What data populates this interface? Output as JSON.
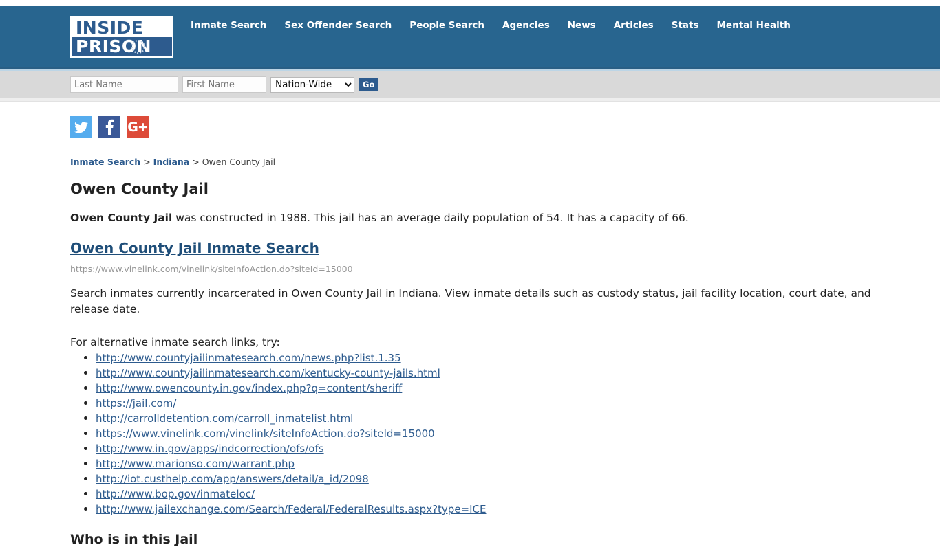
{
  "header": {
    "logo": {
      "line1": "INSIDE",
      "line2": "PRISON",
      "ring_icon": "globe-ring-icon"
    },
    "nav": [
      {
        "label": "Inmate Search"
      },
      {
        "label": "Sex Offender Search"
      },
      {
        "label": "People Search"
      },
      {
        "label": "Agencies"
      },
      {
        "label": "News"
      },
      {
        "label": "Articles"
      },
      {
        "label": "Stats"
      },
      {
        "label": "Mental Health"
      }
    ],
    "bg_color": "#28658f"
  },
  "search": {
    "last_name_placeholder": "Last Name",
    "last_name_value": "",
    "first_name_placeholder": "First Name",
    "first_name_value": "",
    "scope_selected": "Nation-Wide",
    "scope_options": [
      "Nation-Wide"
    ],
    "go_label": "Go",
    "bar_color": "#d9d9d9"
  },
  "social": [
    {
      "name": "twitter-icon",
      "label": "",
      "color": "#55acee"
    },
    {
      "name": "facebook-icon",
      "label": "f",
      "color": "#3b5998"
    },
    {
      "name": "google-plus-icon",
      "label": "G+",
      "color": "#dd4b39"
    }
  ],
  "breadcrumb": {
    "items": [
      {
        "label": "Inmate Search",
        "link": true
      },
      {
        "label": "Indiana",
        "link": true
      },
      {
        "label": "Owen County Jail",
        "link": false
      }
    ],
    "separator": ">"
  },
  "main": {
    "page_title": "Owen County Jail",
    "intro_bold": "Owen County Jail",
    "intro_rest": " was constructed in 1988. This jail has an average daily population of 54. It has a capacity of 66.",
    "inmate_search_link": "Owen County Jail Inmate Search",
    "inmate_search_url": "https://www.vinelink.com/vinelink/siteInfoAction.do?siteId=15000",
    "description": "Search inmates currently incarcerated in Owen County Jail in Indiana. View inmate details such as custody status, jail facility location, court date, and release date.",
    "alt_intro": "For alternative inmate search links, try:",
    "alt_links": [
      "http://www.countyjailinmatesearch.com/news.php?list.1.35",
      "http://www.countyjailinmatesearch.com/kentucky-county-jails.html",
      "http://www.owencounty.in.gov/index.php?q=content/sheriff",
      "https://jail.com/",
      "http://carrolldetention.com/carroll_inmatelist.html",
      "https://www.vinelink.com/vinelink/siteInfoAction.do?siteId=15000",
      "http://www.in.gov/apps/indcorrection/ofs/ofs",
      "http://www.marionso.com/warrant.php",
      "http://iot.custhelp.com/app/answers/detail/a_id/2098",
      "http://www.bop.gov/inmateloc/",
      "http://www.jailexchange.com/Search/Federal/FederalResults.aspx?type=ICE"
    ],
    "section_title": "Who is in this Jail"
  },
  "facility": {
    "name": "Owen County Jail",
    "state": "Indiana",
    "year_constructed": "1988",
    "average_daily_population": "54",
    "capacity": "66"
  }
}
